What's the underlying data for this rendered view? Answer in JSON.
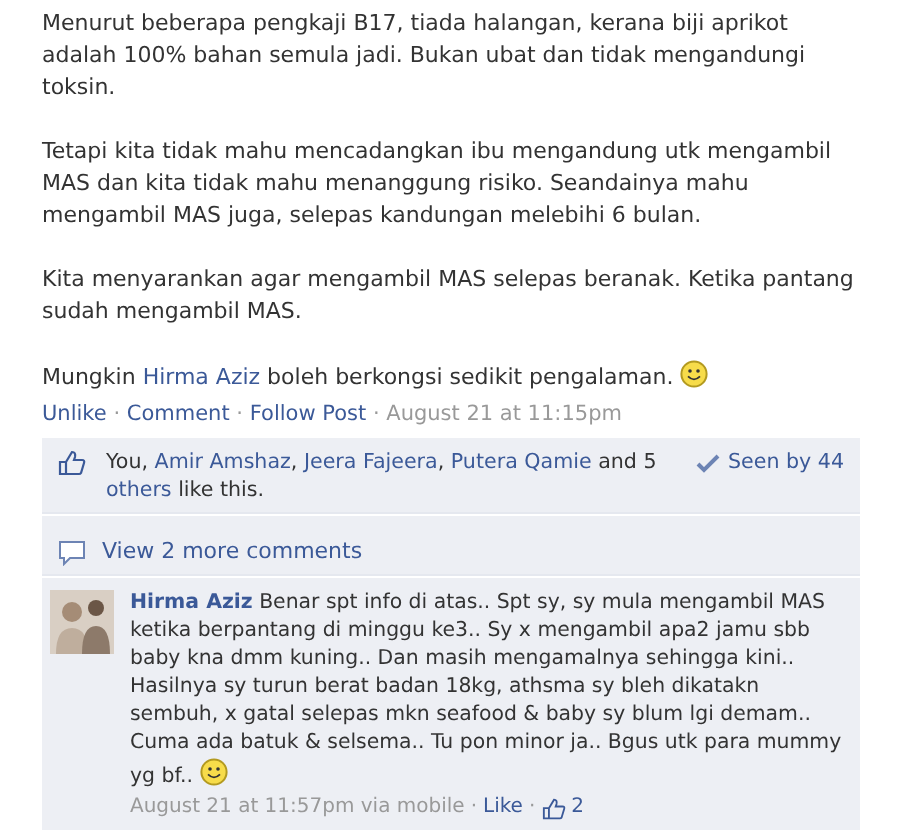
{
  "post": {
    "paragraphs": [
      [
        {
          "kind": "plain",
          "text": "Menurut beberapa pengkaji B17, tiada halangan, kerana biji aprikot adalah 100% bahan semula jadi. Bukan ubat dan tidak mengandungi toksin."
        }
      ],
      [
        {
          "kind": "plain",
          "text": "Tetapi kita tidak mahu mencadangkan ibu mengandung utk mengambil MAS dan kita tidak mahu menanggung risiko. Seandainya mahu mengambil MAS juga, selepas kandungan melebihi 6 bulan."
        }
      ],
      [
        {
          "kind": "plain",
          "text": "Kita menyarankan agar mengambil MAS selepas beranak. Ketika pantang sudah mengambil MAS."
        }
      ],
      [
        {
          "kind": "plain",
          "text": "Mungkin "
        },
        {
          "kind": "link",
          "text": "Hirma Aziz"
        },
        {
          "kind": "plain",
          "text": " boleh berkongsi sedikit pengalaman. "
        },
        {
          "kind": "smiley"
        }
      ]
    ],
    "actions": [
      "Unlike",
      "Comment",
      "Follow Post"
    ],
    "separator": "·",
    "timestamp": "August 21 at 11:15pm"
  },
  "likes": {
    "pieces": [
      {
        "kind": "plain",
        "text": "You, "
      },
      {
        "kind": "link",
        "text": "Amir Amshaz"
      },
      {
        "kind": "plain",
        "text": ", "
      },
      {
        "kind": "link",
        "text": "Jeera Fajeera"
      },
      {
        "kind": "plain",
        "text": ", "
      },
      {
        "kind": "link",
        "text": "Putera Qamie"
      },
      {
        "kind": "plain",
        "text": " and 5 "
      },
      {
        "kind": "link",
        "text": "others"
      },
      {
        "kind": "plain",
        "text": " like this."
      }
    ],
    "seen": "Seen by 44"
  },
  "view_more": "View 2 more comments",
  "comment": {
    "author": "Hirma Aziz",
    "pieces": [
      {
        "kind": "plain",
        "text": "Benar spt info di atas.. Spt sy, sy mula mengambil MAS ketika berpantang di minggu ke3.. Sy x mengambil apa2 jamu sbb baby kna dmm kuning.. Dan masih mengamalnya sehingga kini.. Hasilnya sy turun berat badan 18kg, athsma sy bleh dikatakn sembuh, x gatal selepas mkn seafood & baby sy blum lgi demam.. Cuma ada batuk & selsema.. Tu pon minor ja.. Bgus utk para mummy yg bf.. "
      },
      {
        "kind": "smiley"
      }
    ],
    "time": "August 21 at 11:57pm via mobile",
    "like": "Like",
    "like_count": "2"
  }
}
